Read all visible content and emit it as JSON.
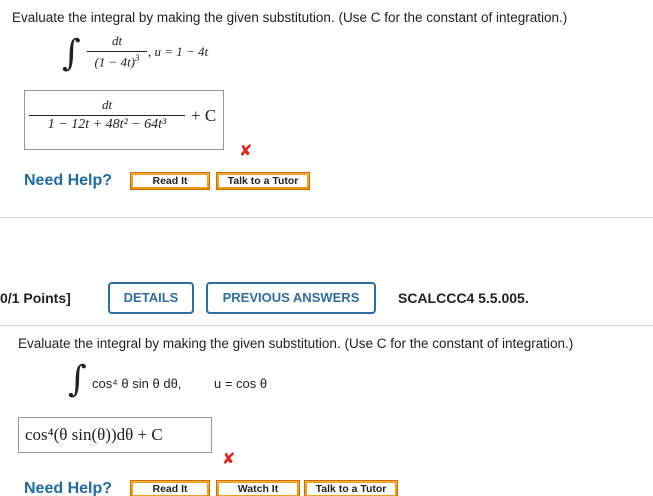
{
  "q1": {
    "prompt": "Evaluate the integral by making the given substitution. (Use C for the constant of integration.)",
    "integrand_num": "dt",
    "integrand_den": "(1 − 4t)",
    "integrand_den_exp": "3",
    "substitution": ",  u = 1 − 4t",
    "answer_num": "dt",
    "answer_den": "1 − 12t + 48t² − 64t³",
    "answer_const": "+ C",
    "status_mark": "✘",
    "need_help": "Need Help?",
    "buttons": [
      "Read It",
      "Talk to a Tutor"
    ]
  },
  "q2": {
    "points": "0/1 Points]",
    "details_label": "DETAILS",
    "previous_answers_label": "PREVIOUS ANSWERS",
    "code": "SCALCCC4 5.5.005.",
    "prompt": "Evaluate the integral by making the given substitution. (Use C for the constant of integration.)",
    "integrand": "cos⁴ θ sin θ dθ,",
    "substitution": "u = cos θ",
    "answer": "cos⁴(θ sin(θ))dθ + C",
    "status_mark": "✘",
    "need_help": "Need Help?",
    "buttons": [
      "Read It",
      "Watch It",
      "Talk to a Tutor"
    ]
  },
  "colors": {
    "link_blue": "#1f6aa5",
    "button_orange": "#f08c00",
    "error_red": "#e0241b",
    "outline_blue": "#2e6da4"
  }
}
